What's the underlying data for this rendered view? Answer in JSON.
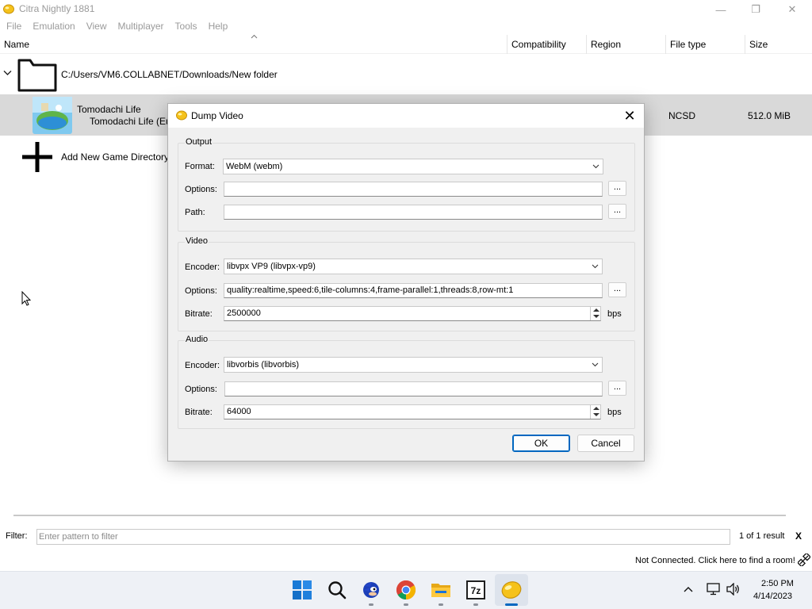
{
  "window": {
    "title": "Citra Nightly 1881",
    "minimize": "—",
    "maximize": "❐",
    "close": "✕"
  },
  "menu": [
    "File",
    "Emulation",
    "View",
    "Multiplayer",
    "Tools",
    "Help"
  ],
  "columns": [
    "Name",
    "Compatibility",
    "Region",
    "File type",
    "Size"
  ],
  "directory": {
    "expander": "⌄",
    "path": "C:/Users/VM6.COLLABNET/Downloads/New folder"
  },
  "game": {
    "title": "Tomodachi Life",
    "subtitle": "Tomodachi Life (Eu",
    "file_type": "NCSD",
    "size": "512.0 MiB"
  },
  "add_directory": "Add New Game Directory",
  "dialog": {
    "title": "Dump Video",
    "close": "✕",
    "output": {
      "group_title": "Output",
      "format_label": "Format:",
      "format_value": "WebM (webm)",
      "options_label": "Options:",
      "options_value": "",
      "path_label": "Path:",
      "path_value": "",
      "dots": "..."
    },
    "video": {
      "group_title": "Video",
      "encoder_label": "Encoder:",
      "encoder_value": "libvpx VP9 (libvpx-vp9)",
      "options_label": "Options:",
      "options_value": "quality:realtime,speed:6,tile-columns:4,frame-parallel:1,threads:8,row-mt:1",
      "bitrate_label": "Bitrate:",
      "bitrate_value": "2500000",
      "bitrate_unit": "bps",
      "dots": "..."
    },
    "audio": {
      "group_title": "Audio",
      "encoder_label": "Encoder:",
      "encoder_value": "libvorbis (libvorbis)",
      "options_label": "Options:",
      "options_value": "",
      "bitrate_label": "Bitrate:",
      "bitrate_value": "64000",
      "bitrate_unit": "bps",
      "dots": "..."
    },
    "ok": "OK",
    "cancel": "Cancel"
  },
  "filter": {
    "label": "Filter:",
    "placeholder": "Enter pattern to filter",
    "result_count": "1 of 1 result",
    "clear": "X"
  },
  "status": {
    "network": "Not Connected. Click here to find a room!"
  },
  "taskbar": {
    "icons": [
      "windows-start-icon",
      "search-icon",
      "sonic-icon",
      "chrome-icon",
      "file-explorer-icon",
      "7zip-icon",
      "citra-icon"
    ],
    "time": "2:50 PM",
    "date": "4/14/2023"
  },
  "colors": {
    "accent": "#0067c0",
    "selected_row": "#d9d9d9",
    "citra_yellow": "#f5c21b"
  }
}
